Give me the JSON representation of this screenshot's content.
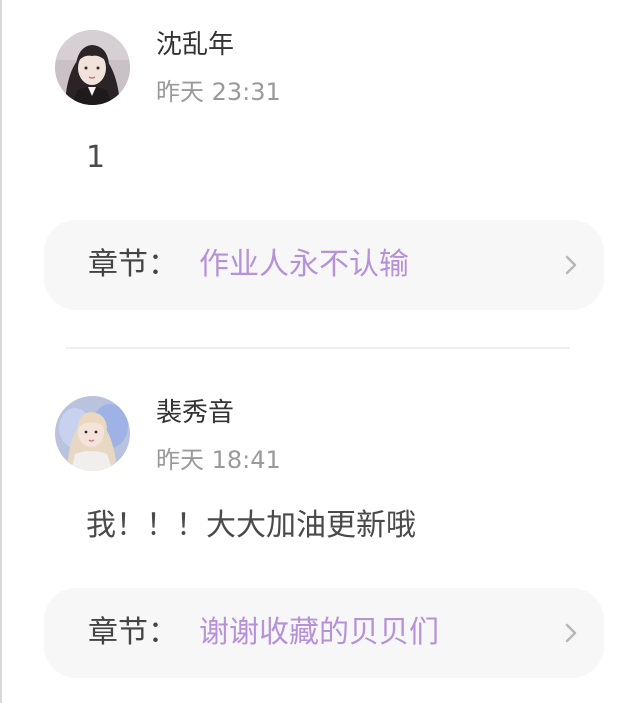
{
  "comments": [
    {
      "username": "沈乱年",
      "time": "昨天 23:31",
      "content": "1",
      "chapter_label": "章节：",
      "chapter_title": "作业人永不认输"
    },
    {
      "username": "裴秀音",
      "time": "昨天 18:41",
      "content": "我！！！大大加油更新哦",
      "chapter_label": "章节：",
      "chapter_title": "谢谢收藏的贝贝们"
    }
  ],
  "colors": {
    "accent": "#b692d8",
    "chapter_bg": "#f7f7f7",
    "time": "#9a9a9a"
  },
  "icons": [
    "avatar",
    "chevron-right-icon"
  ]
}
